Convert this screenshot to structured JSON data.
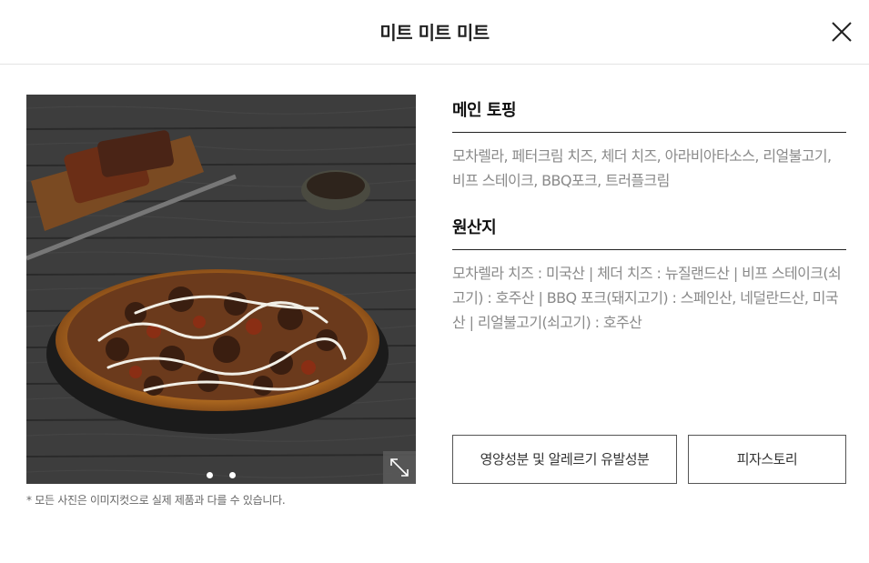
{
  "header": {
    "title": "미트 미트 미트",
    "close_icon": "close-icon"
  },
  "gallery": {
    "image_alt": "pizza-photo",
    "dots": 2,
    "expand_icon": "expand-icon",
    "notice": "* 모든 사진은 이미지컷으로 실제 제품과 다를 수 있습니다."
  },
  "toppings": {
    "title": "메인 토핑",
    "text": "모차렐라, 페터크림 치즈, 체더 치즈, 아라비아타소스, 리얼불고기, 비프 스테이크, BBQ포크, 트러플크림"
  },
  "origin": {
    "title": "원산지",
    "text": "모차렐라 치즈 : 미국산 | 체더 치즈 : 뉴질랜드산 | 비프 스테이크(쇠고기) : 호주산 |  BBQ 포크(돼지고기) : 스페인산, 네덜란드산, 미국산 | 리얼불고기(쇠고기) : 호주산"
  },
  "buttons": {
    "nutrition": "영양성분 및 알레르기 유발성분",
    "story": "피자스토리"
  }
}
